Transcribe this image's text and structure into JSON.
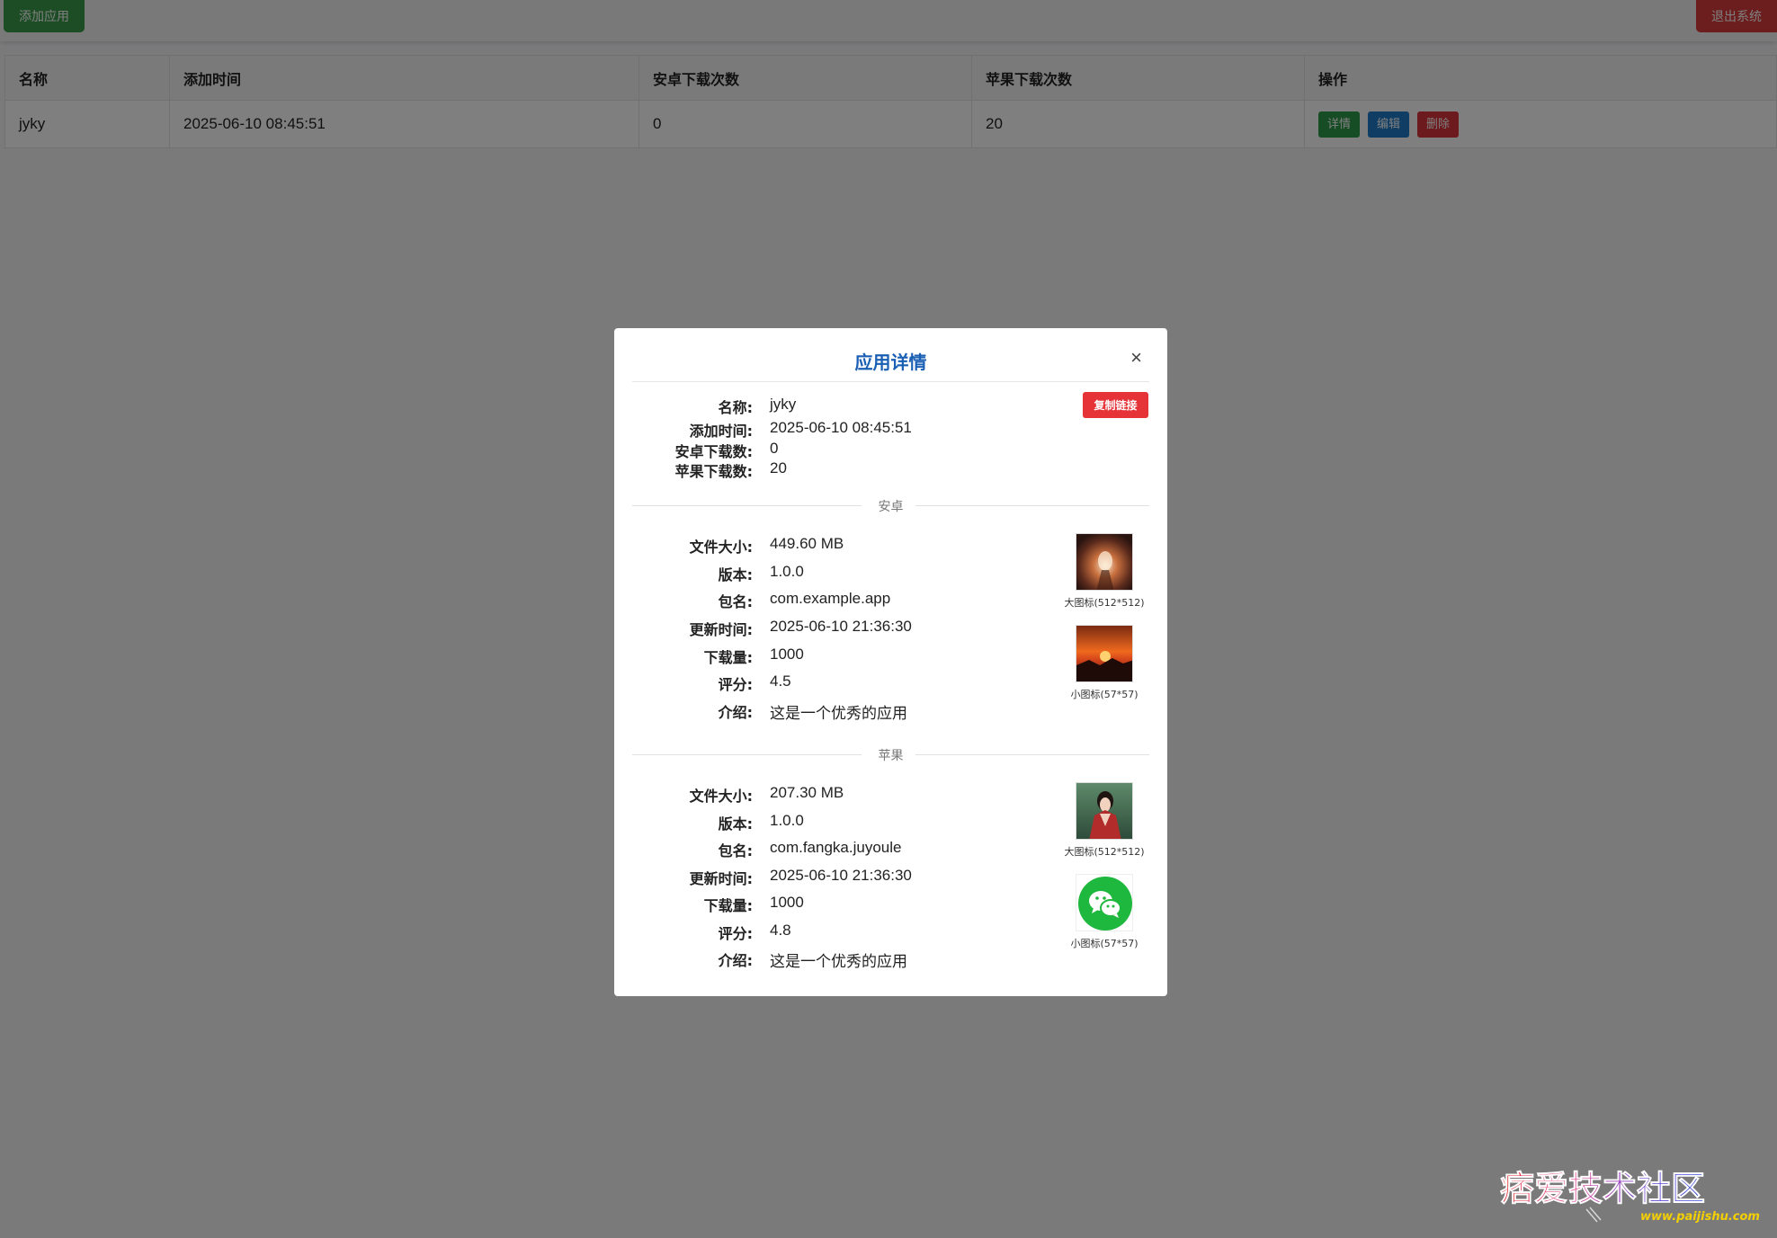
{
  "topbar": {
    "add_label": "添加应用",
    "exit_label": "退出系统"
  },
  "table": {
    "headers": [
      "名称",
      "添加时间",
      "安卓下载次数",
      "苹果下载次数",
      "操作"
    ],
    "rows": [
      {
        "name": "jyky",
        "added": "2025-06-10 08:45:51",
        "android_downloads": "0",
        "ios_downloads": "20",
        "actions": [
          "详情",
          "编辑",
          "删除"
        ]
      }
    ]
  },
  "modal": {
    "title": "应用详情",
    "close": "×",
    "copy_label": "复制链接",
    "summary": [
      {
        "label": "名称:",
        "value": "jyky"
      },
      {
        "label": "添加时间:",
        "value": "2025-06-10 08:45:51"
      },
      {
        "label": "安卓下载数:",
        "value": "0"
      },
      {
        "label": "苹果下载数:",
        "value": "20"
      }
    ],
    "android": {
      "title": "安卓",
      "fields": [
        {
          "label": "文件大小:",
          "value": "449.60 MB"
        },
        {
          "label": "版本:",
          "value": "1.0.0"
        },
        {
          "label": "包名:",
          "value": "com.example.app"
        },
        {
          "label": "更新时间:",
          "value": "2025-06-10 21:36:30"
        },
        {
          "label": "下载量:",
          "value": "1000"
        },
        {
          "label": "评分:",
          "value": "4.5"
        },
        {
          "label": "介绍:",
          "value": "这是一个优秀的应用"
        }
      ],
      "icon_large_caption": "大图标(512*512)",
      "icon_small_caption": "小图标(57*57)"
    },
    "ios": {
      "title": "苹果",
      "fields": [
        {
          "label": "文件大小:",
          "value": "207.30 MB"
        },
        {
          "label": "版本:",
          "value": "1.0.0"
        },
        {
          "label": "包名:",
          "value": "com.fangka.juyoule"
        },
        {
          "label": "更新时间:",
          "value": "2025-06-10 21:36:30"
        },
        {
          "label": "下载量:",
          "value": "1000"
        },
        {
          "label": "评分:",
          "value": "4.8"
        },
        {
          "label": "介绍:",
          "value": "这是一个优秀的应用"
        }
      ],
      "icon_large_caption": "大图标(512*512)",
      "icon_small_caption": "小图标(57*57)"
    }
  },
  "watermark": {
    "title": "痞爱技术社区",
    "url": "www.paijishu.com"
  },
  "colors": {
    "green": "#3a9b4a",
    "blue": "#1f7bc9",
    "red": "#d8343a",
    "title_blue": "#1a5fb4",
    "copy_red": "#e53338",
    "wechat_green": "#1fb83e"
  }
}
